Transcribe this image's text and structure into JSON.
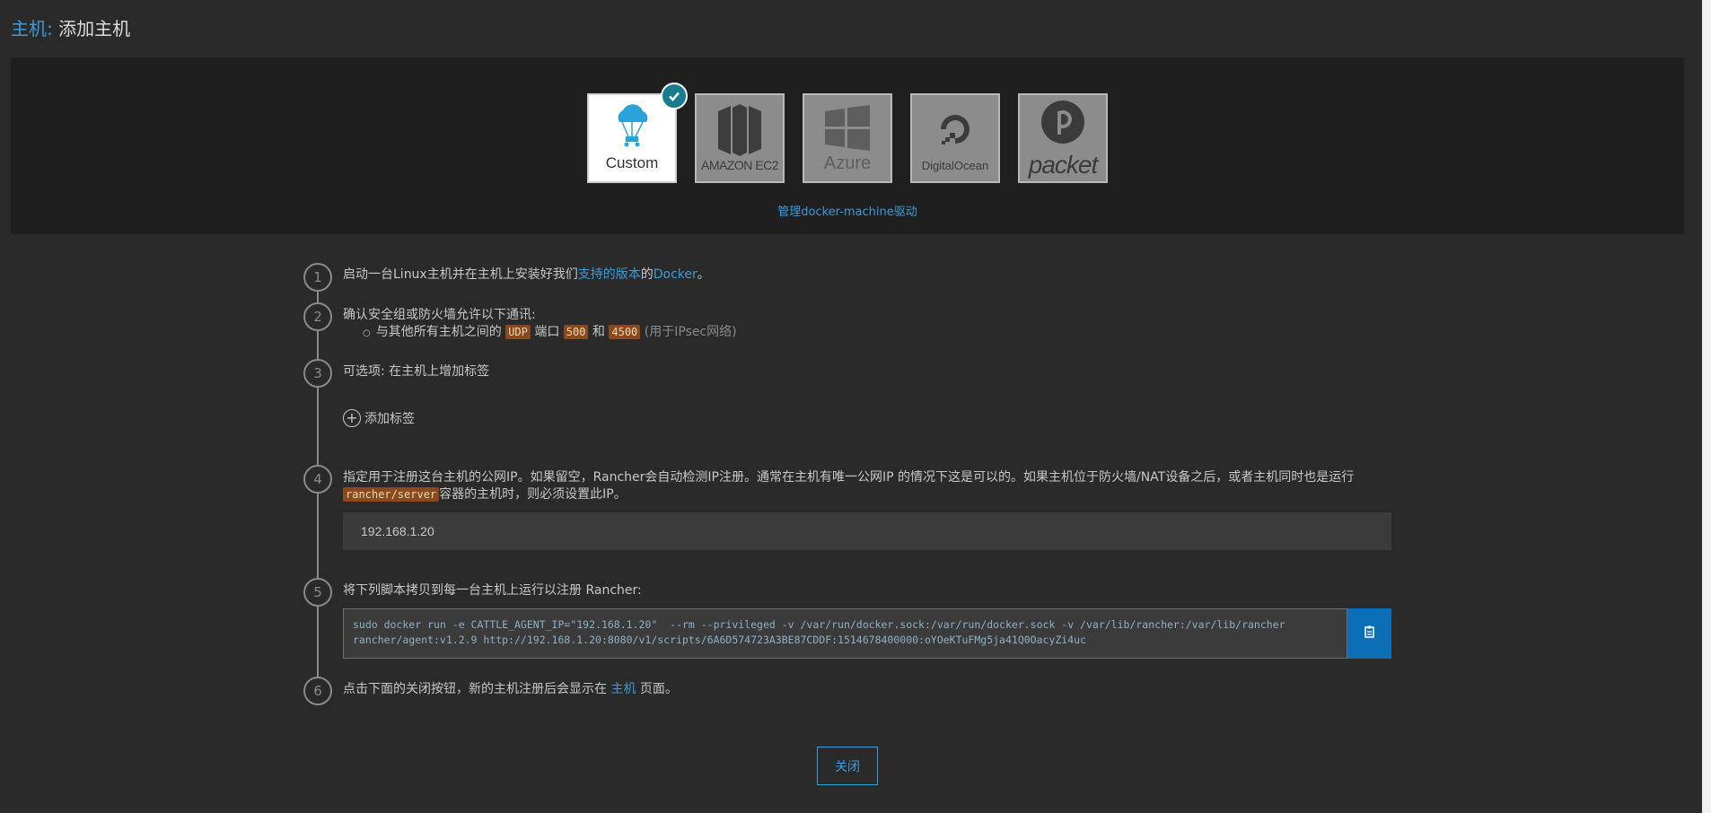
{
  "header": {
    "crumb": "主机:",
    "title": "添加主机"
  },
  "drivers": [
    {
      "label": "Custom",
      "icon": "cloud-parachute-icon",
      "active": true
    },
    {
      "label": "AMAZON EC2",
      "icon": "amazon-ec2-icon",
      "active": false
    },
    {
      "label": "Azure",
      "icon": "azure-windows-icon",
      "active": false
    },
    {
      "label": "DigitalOcean",
      "icon": "digitalocean-icon",
      "active": false
    },
    {
      "label": "packet",
      "icon": "packet-icon",
      "active": false
    }
  ],
  "manage_link": "管理docker-machine驱动",
  "steps": {
    "s1": {
      "num": "1",
      "pre": "启动一台Linux主机并在主机上安装好我们",
      "link1": "支持的版本",
      "mid": "的",
      "link2": "Docker",
      "post": "。"
    },
    "s2": {
      "num": "2",
      "text": "确认安全组或防火墙允许以下通讯:",
      "bullet_pre": "与其他所有主机之间的",
      "proto": "UDP",
      "port_word": "端口",
      "port1": "500",
      "and": "和",
      "port2": "4500",
      "note": "(用于IPsec网络)"
    },
    "s3": {
      "num": "3",
      "text": "可选项: 在主机上增加标签",
      "add_label": "添加标签"
    },
    "s4": {
      "num": "4",
      "line1": "指定用于注册这台主机的公网IP。如果留空，Rancher会自动检测IP注册。通常在主机有唯一公网IP 的情况下这是可以的。如果主机位于防火墙/NAT设备之后，或者主机同时也是运行",
      "tag": "rancher/server",
      "line2": "容器的主机时，则必须设置此IP。",
      "ip_value": "192.168.1.20"
    },
    "s5": {
      "num": "5",
      "text": "将下列脚本拷贝到每一台主机上运行以注册 Rancher:",
      "code": "sudo docker run -e CATTLE_AGENT_IP=\"192.168.1.20\"  --rm --privileged -v /var/run/docker.sock:/var/run/docker.sock -v /var/lib/rancher:/var/lib/rancher\nrancher/agent:v1.2.9 http://192.168.1.20:8080/v1/scripts/6A6D574723A3BE87CDDF:1514678400000:oYOeKTuFMg5ja41Q0OacyZi4uc"
    },
    "s6": {
      "num": "6",
      "pre": "点击下面的关闭按钮，新的主机注册后会显示在 ",
      "link": "主机",
      "post": " 页面。"
    }
  },
  "close_label": "关闭",
  "colors": {
    "accent": "#3d9bd8",
    "badge": "#177d8e",
    "copy_button": "#0a6fb6",
    "tag_bg": "#8a4a1e"
  }
}
